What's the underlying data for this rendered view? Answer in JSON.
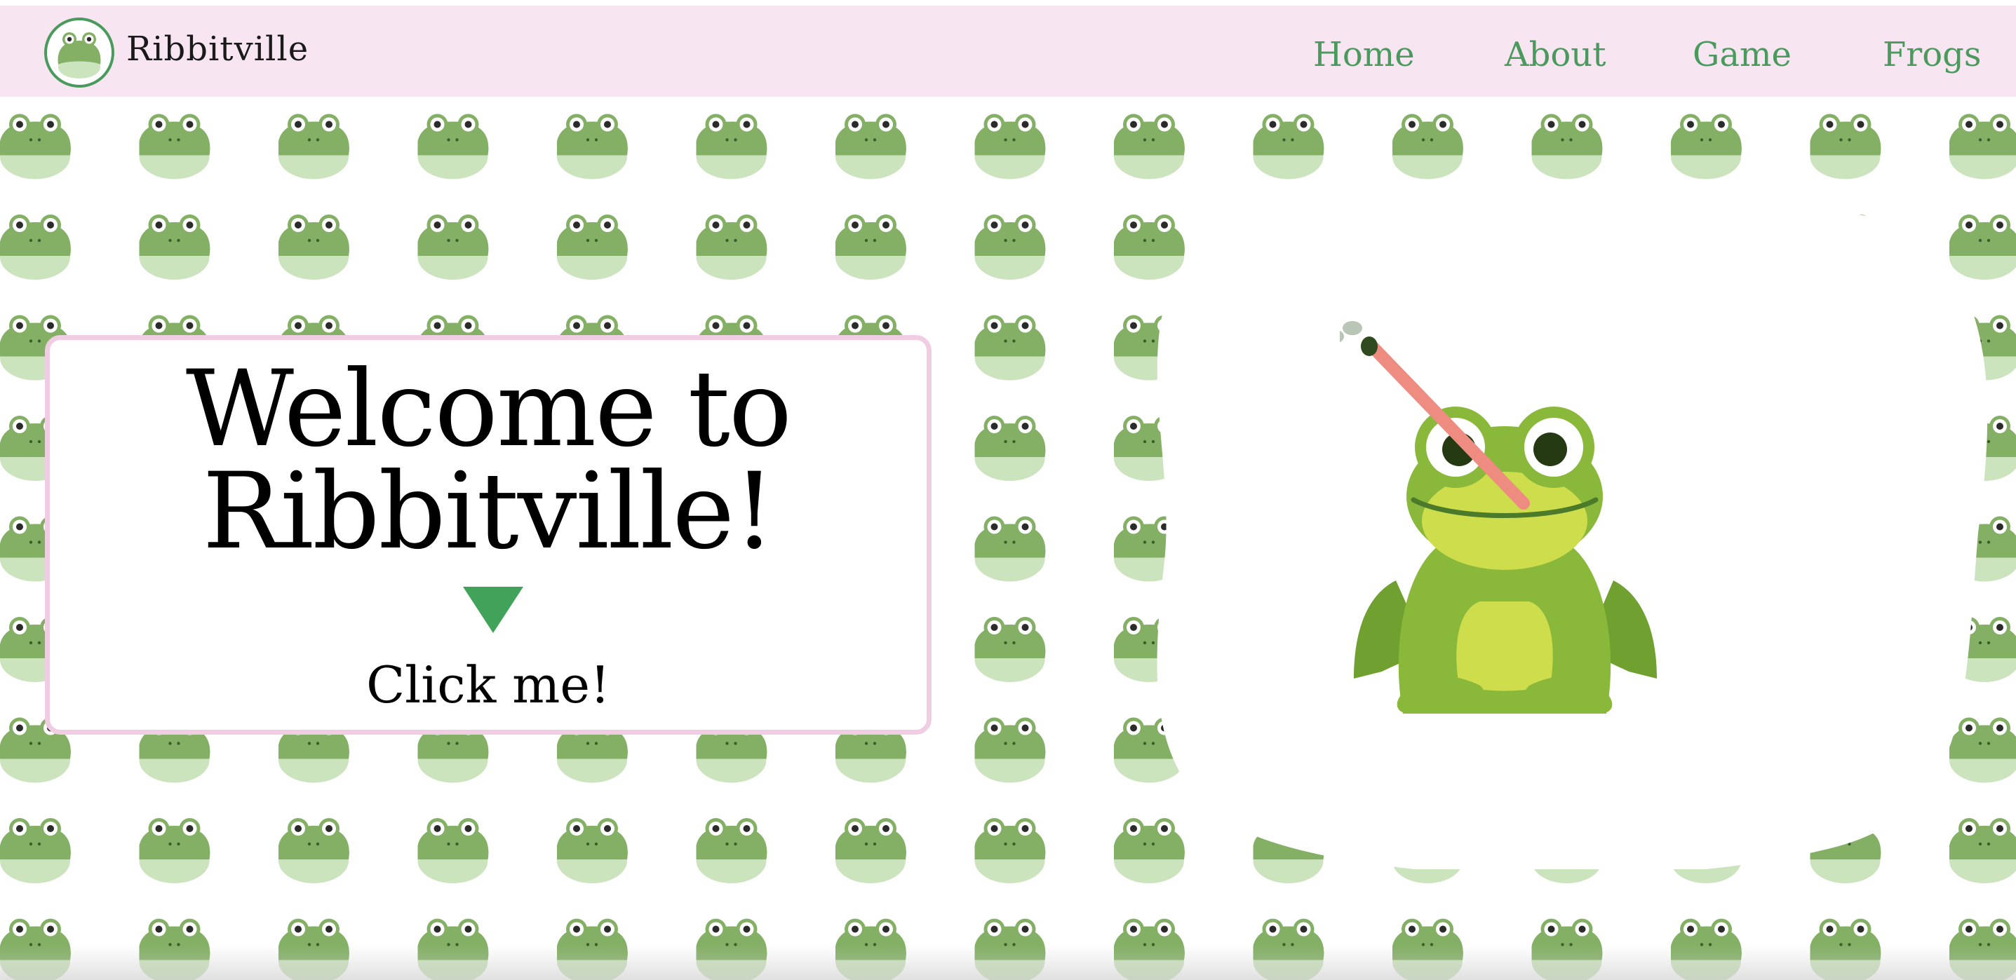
{
  "site": {
    "brand_name": "Ribbitville",
    "logo_icon": "frog-face-icon"
  },
  "nav": {
    "links": [
      {
        "label": "Home"
      },
      {
        "label": "About"
      },
      {
        "label": "Game"
      },
      {
        "label": "Frogs"
      }
    ]
  },
  "hero": {
    "title_line1": "Welcome to",
    "title_line2": "Ribbitville!",
    "cta_label": "Click me!",
    "arrow_icon": "triangle-down-icon",
    "illustration": "frog-catching-fly-icon"
  },
  "background": {
    "pattern_icon": "frog-face-icon"
  },
  "colors": {
    "nav_bg": "#f7e6f1",
    "nav_link": "#4a9a5e",
    "card_border": "#f1cde3",
    "arrow": "#41a35a",
    "frog_pattern": "#84b065",
    "frog_pattern_belly": "#cce4bd"
  }
}
